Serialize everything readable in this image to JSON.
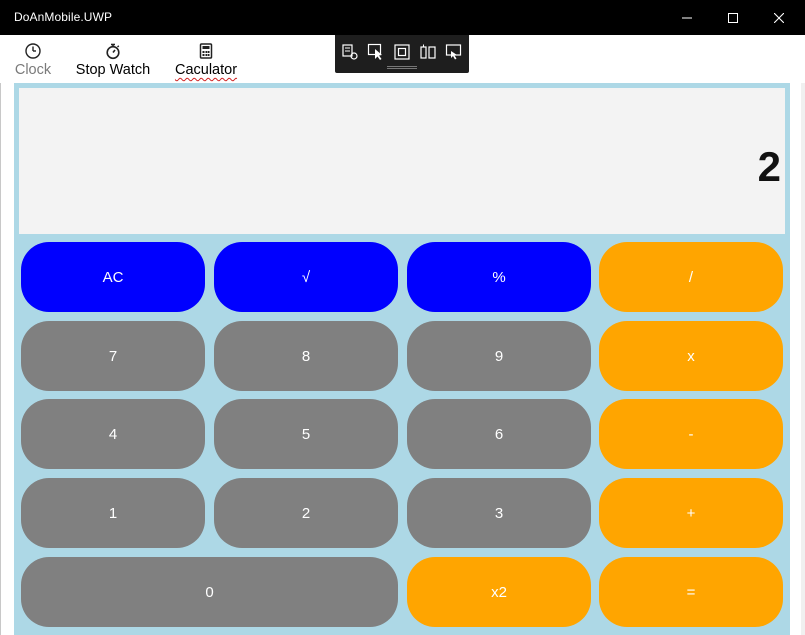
{
  "window": {
    "title": "DoAnMobile.UWP"
  },
  "nav": {
    "items": [
      {
        "label": "Clock",
        "icon": "clock-icon"
      },
      {
        "label": "Stop Watch",
        "icon": "stopwatch-icon"
      },
      {
        "label": "Caculator",
        "icon": "calculator-icon"
      }
    ],
    "selected": "Caculator"
  },
  "display": {
    "value": "2"
  },
  "keys": {
    "ac": "AC",
    "sqrt": "√",
    "percent": "%",
    "divide": "/",
    "seven": "7",
    "eight": "8",
    "nine": "9",
    "multiply": "x",
    "four": "4",
    "five": "5",
    "six": "6",
    "minus": "-",
    "one": "1",
    "two": "2",
    "three": "3",
    "plus": "+",
    "zero": "0",
    "square": "x2",
    "equals": "="
  },
  "colors": {
    "function_keys": "#0000ff",
    "number_keys": "#808080",
    "operator_keys": "#ffa500",
    "calculator_background": "#add8e6",
    "display_background": "#f3f3f3"
  }
}
